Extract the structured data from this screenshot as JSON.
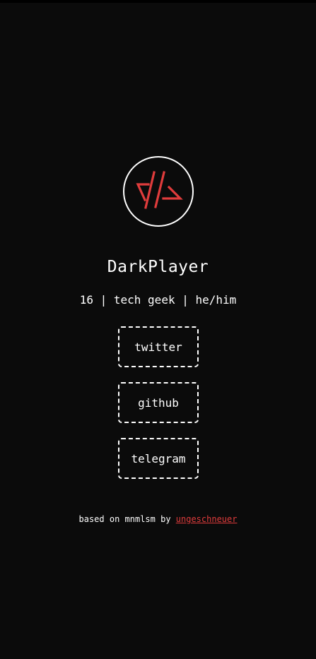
{
  "profile": {
    "avatar_icon": "dp-logo-icon",
    "name": "DarkPlayer",
    "bio": "16 | tech geek | he/him"
  },
  "links": [
    {
      "label": "twitter"
    },
    {
      "label": "github"
    },
    {
      "label": "telegram"
    }
  ],
  "footer": {
    "prefix": "based on mnmlsm by ",
    "author_link": "ungeschneuer"
  },
  "colors": {
    "background": "#0b0b0b",
    "text": "#ffffff",
    "accent": "#e03c3c"
  }
}
